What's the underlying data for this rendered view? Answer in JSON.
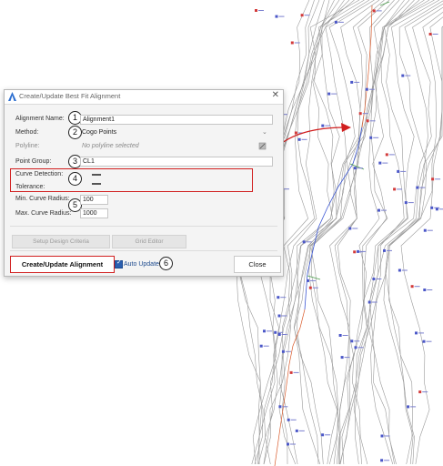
{
  "dialog": {
    "title": "Create/Update Best Fit Alignment",
    "close_glyph": "✕",
    "alignment_name_label": "Alignment Name:",
    "alignment_name_value": "Alignment1",
    "method_label": "Method:",
    "method_value": "Cogo Points",
    "polyline_label": "Polyline:",
    "polyline_value": "No polyline selected",
    "point_group_label": "Point Group:",
    "point_group_value": "CL1",
    "curve_detection_label": "Curve Detection:",
    "tolerance_label": "Tolerance:",
    "min_curve_radius_label": "Min. Curve Radius:",
    "min_curve_radius_value": "100",
    "max_curve_radius_label": "Max. Curve Radius:",
    "max_curve_radius_value": "1000",
    "setup_design_criteria_label": "Setup Design Criteria",
    "grid_editor_label": "Grid Editor",
    "create_update_label": "Create/Update Alignment",
    "auto_update_label": "Auto Update",
    "auto_update_checked": true,
    "close_label": "Close"
  },
  "callouts": [
    "1",
    "2",
    "3",
    "4",
    "5",
    "6"
  ],
  "icons": [
    "autocad-app-icon",
    "close-icon",
    "chevron-down-icon",
    "select-polyline-icon",
    "checkbox-icon",
    "arrow-icon"
  ],
  "colors": {
    "callout_red": "#d11f1f",
    "alignment_blue": "#2b5fb0",
    "contour": "#9a9a9a"
  }
}
